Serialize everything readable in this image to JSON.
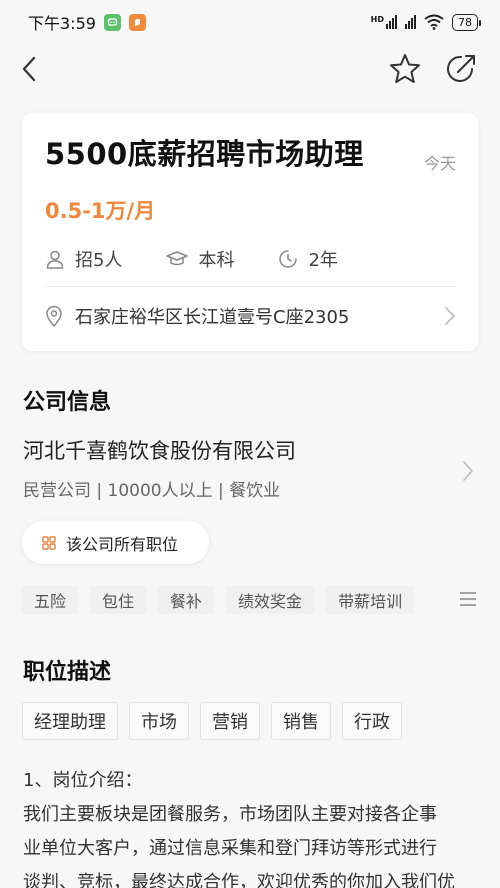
{
  "status_bar": {
    "time": "下午3:59",
    "network": "HD",
    "battery": "78"
  },
  "job": {
    "title": "5500底薪招聘市场助理",
    "posted": "今天",
    "salary": "0.5-1万/月",
    "headcount": "招5人",
    "education": "本科",
    "experience": "2年",
    "address": "石家庄裕华区长江道壹号C座2305"
  },
  "company": {
    "section_title": "公司信息",
    "name": "河北千喜鹤饮食股份有限公司",
    "meta": "民营公司 | 10000人以上 | 餐饮业",
    "all_jobs_label": "该公司所有职位",
    "benefits": [
      "五险",
      "包住",
      "餐补",
      "绩效奖金",
      "带薪培训"
    ]
  },
  "description": {
    "section_title": "职位描述",
    "tags": [
      "经理助理",
      "市场",
      "营销",
      "销售",
      "行政"
    ],
    "lines": [
      "1、岗位介绍：",
      "我们主要板块是团餐服务，市场团队主要对接各企事",
      "业单位大客户，通过信息采集和登门拜访等形式进行",
      "谈判、竞标，最终达成合作，欢迎优秀的你加入我们优"
    ]
  },
  "colors": {
    "salary": "#f0873a",
    "accent_icon": "#e8843a"
  }
}
